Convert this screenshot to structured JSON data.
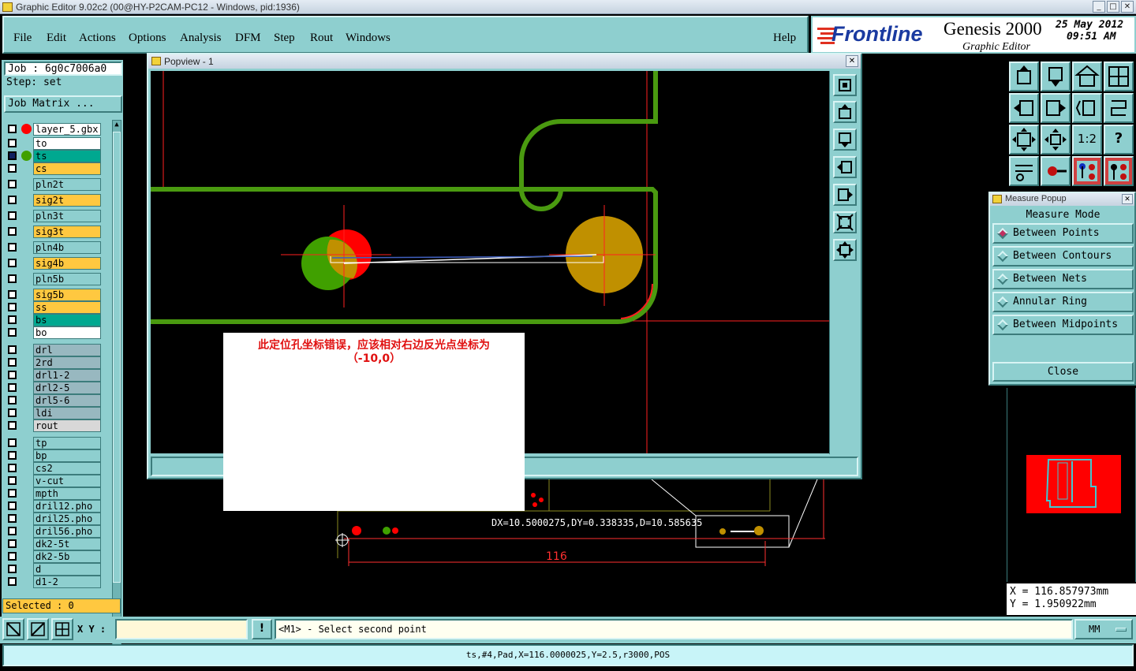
{
  "window": {
    "title": "Graphic Editor 9.02c2 (00@HY-P2CAM-PC12 - Windows, pid:1936)"
  },
  "menu": [
    "File",
    "Edit",
    "Actions",
    "Options",
    "Analysis",
    "DFM",
    "Step",
    "Rout",
    "Windows"
  ],
  "help_label": "Help",
  "logo": {
    "brand": "Frontline",
    "product": "Genesis 2000",
    "subtitle": "Graphic Editor",
    "date": "25 May 2012",
    "time": "09:51 AM"
  },
  "job": {
    "job_label": "Job : 6g0c7006a0",
    "step_label": "Step: set",
    "matrix_button": "Job Matrix ..."
  },
  "layers": [
    {
      "name": "layer_5.gbx",
      "color": "#ffffff",
      "dot": "#ff0000",
      "checked": false
    },
    {
      "name": "to",
      "color": "#ffffff",
      "checked": false
    },
    {
      "name": "ts",
      "color": "#00a890",
      "dot": "#40a000",
      "checked": true
    },
    {
      "name": "cs",
      "color": "#ffc840",
      "checked": false
    },
    {
      "name": "pln2t",
      "color": "#8ecfcf",
      "checked": false
    },
    {
      "name": "sig2t",
      "color": "#ffc840",
      "checked": false
    },
    {
      "name": "pln3t",
      "color": "#8ecfcf",
      "checked": false
    },
    {
      "name": "sig3t",
      "color": "#ffc840",
      "checked": false
    },
    {
      "name": "pln4b",
      "color": "#8ecfcf",
      "checked": false
    },
    {
      "name": "sig4b",
      "color": "#ffc840",
      "checked": false
    },
    {
      "name": "pln5b",
      "color": "#8ecfcf",
      "checked": false
    },
    {
      "name": "sig5b",
      "color": "#ffc840",
      "checked": false
    },
    {
      "name": "ss",
      "color": "#ffc840",
      "checked": false
    },
    {
      "name": "bs",
      "color": "#00a890",
      "checked": false
    },
    {
      "name": "bo",
      "color": "#ffffff",
      "checked": false
    },
    {
      "name": "drl",
      "color": "#98b8c0",
      "checked": false
    },
    {
      "name": "2rd",
      "color": "#98b8c0",
      "checked": false
    },
    {
      "name": "drl1-2",
      "color": "#98b8c0",
      "checked": false
    },
    {
      "name": "drl2-5",
      "color": "#98b8c0",
      "checked": false
    },
    {
      "name": "drl5-6",
      "color": "#98b8c0",
      "checked": false
    },
    {
      "name": "ldi",
      "color": "#98b8c0",
      "checked": false
    },
    {
      "name": "rout",
      "color": "#d8d8d8",
      "checked": false
    },
    {
      "name": "tp",
      "color": "#8ecfcf",
      "checked": false
    },
    {
      "name": "bp",
      "color": "#8ecfcf",
      "checked": false
    },
    {
      "name": "cs2",
      "color": "#8ecfcf",
      "checked": false
    },
    {
      "name": "v-cut",
      "color": "#8ecfcf",
      "checked": false
    },
    {
      "name": "mpth",
      "color": "#8ecfcf",
      "checked": false
    },
    {
      "name": "dril12.pho",
      "color": "#8ecfcf",
      "checked": false
    },
    {
      "name": "dril25.pho",
      "color": "#8ecfcf",
      "checked": false
    },
    {
      "name": "dril56.pho",
      "color": "#8ecfcf",
      "checked": false
    },
    {
      "name": "dk2-5t",
      "color": "#8ecfcf",
      "checked": false
    },
    {
      "name": "dk2-5b",
      "color": "#8ecfcf",
      "checked": false
    },
    {
      "name": "d",
      "color": "#8ecfcf",
      "checked": false
    },
    {
      "name": "d1-2",
      "color": "#8ecfcf",
      "checked": false
    }
  ],
  "selected_label": "Selected : 0",
  "popview": {
    "title": "Popview - 1",
    "close": "✕"
  },
  "annotation": {
    "line1": "此定位孔坐标错误，应该相对右边反光点坐标为",
    "line2": "（-10,0）"
  },
  "canvas": {
    "measure_text": "DX=10.5000275,DY=0.338335,D=10.585635",
    "dimension": "116"
  },
  "measure": {
    "title": "Measure Popup",
    "mode_label": "Measure Mode",
    "options": [
      {
        "label": "Between Points",
        "on": true
      },
      {
        "label": "Between Contours",
        "on": false
      },
      {
        "label": "Between Nets",
        "on": false
      },
      {
        "label": "Annular Ring",
        "on": false
      },
      {
        "label": "Between Midpoints",
        "on": false
      }
    ],
    "close_label": "Close"
  },
  "coords": {
    "x": "X  =  116.857973mm",
    "y": "Y  =  1.950922mm"
  },
  "bottom": {
    "xy_label": "X Y :",
    "xy_value": "",
    "prompt": "<M1> - Select second point",
    "units": "MM",
    "status": "ts,#4,Pad,X=116.0000025,Y=2.5,r3000,POS"
  },
  "colors": {
    "panel": "#8ecfcf",
    "green": "#4a9a10",
    "red": "#ff0000",
    "gold": "#c09000"
  }
}
